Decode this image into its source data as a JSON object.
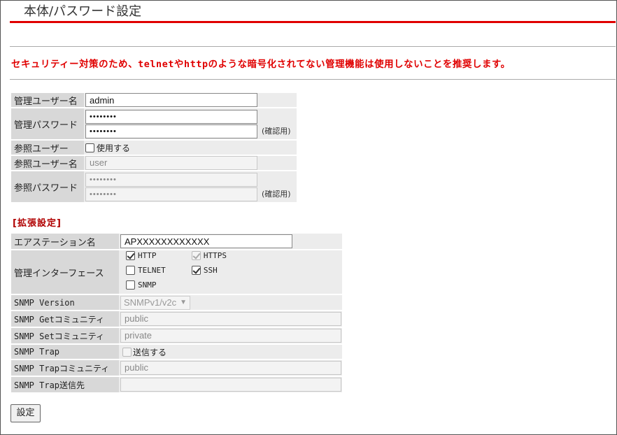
{
  "page": {
    "title": "本体/パスワード設定",
    "warning": "セキュリティー対策のため、telnetやhttpのような暗号化されてない管理機能は使用しないことを推奨します。"
  },
  "basic": {
    "admin_user_label": "管理ユーザー名",
    "admin_user_value": "admin",
    "admin_pw_label": "管理パスワード",
    "admin_pw_value": "••••••••",
    "admin_pw_confirm_value": "••••••••",
    "confirm_note": "(確認用)",
    "ref_user_label": "参照ユーザー",
    "ref_user_use_label": "使用する",
    "ref_user_use_checked": false,
    "ref_user_name_label": "参照ユーザー名",
    "ref_user_name_value": "user",
    "ref_pw_label": "参照パスワード",
    "ref_pw_value": "••••••••",
    "ref_pw_confirm_value": "••••••••",
    "ref_confirm_note": "(確認用)"
  },
  "extended": {
    "section_title": "[拡張設定]",
    "airstation_label": "エアステーション名",
    "airstation_value": "APXXXXXXXXXXXX",
    "mgmt_if_label": "管理インターフェース",
    "http_label": "HTTP",
    "https_label": "HTTPS",
    "telnet_label": "TELNET",
    "ssh_label": "SSH",
    "snmp_label": "SNMP",
    "snmp_version_label": "SNMP Version",
    "snmp_version_value": "SNMPv1/v2c",
    "snmp_get_label": "SNMP Getコミュニティ",
    "snmp_get_value": "public",
    "snmp_set_label": "SNMP Setコミュニティ",
    "snmp_set_value": "private",
    "snmp_trap_label": "SNMP Trap",
    "snmp_trap_send_label": "送信する",
    "snmp_trap_comm_label": "SNMP Trapコミュニティ",
    "snmp_trap_comm_value": "public",
    "snmp_trap_dest_label": "SNMP Trap送信先",
    "snmp_trap_dest_value": ""
  },
  "checkboxes": {
    "http": true,
    "https": true,
    "telnet": false,
    "ssh": true,
    "snmp": false,
    "snmp_trap": false
  },
  "actions": {
    "submit_label": "設定"
  }
}
